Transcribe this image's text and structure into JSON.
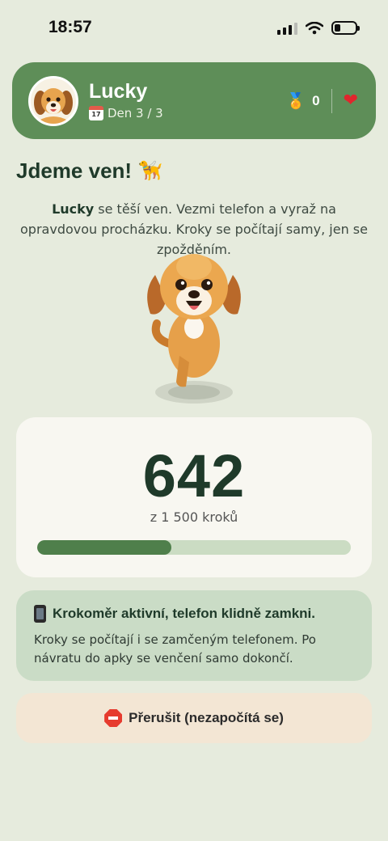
{
  "status_bar": {
    "time": "18:57"
  },
  "header": {
    "pet_name": "Lucky",
    "day_label": "Den 3 / 3",
    "medal_count": "0",
    "icons": [
      "calendar-icon",
      "medal-icon",
      "heart-icon"
    ]
  },
  "walk": {
    "title": "Jdeme ven!",
    "intro_name": "Lucky",
    "intro_text": " se těší ven. Vezmi telefon a vyraž na opravdovou procházku. Kroky se počítají samy, jen se zpožděním."
  },
  "steps": {
    "value": "642",
    "goal_text": "z 1 500 kroků",
    "progress": 0.428
  },
  "pedometer": {
    "title": "Krokoměr aktivní, telefon klidně zamkni.",
    "text": "Kroky se počítají i se zamčeným telefonem. Po návratu do apky se venčení samo dokončí."
  },
  "actions": {
    "stop_label": "Přerušit (nezapočítá se)"
  },
  "colors": {
    "background": "#e6ebdd",
    "header": "#5e8e58",
    "progress": "#4f7f4b",
    "info_card": "#cadcc6",
    "stop_button": "#f3e6d4"
  }
}
